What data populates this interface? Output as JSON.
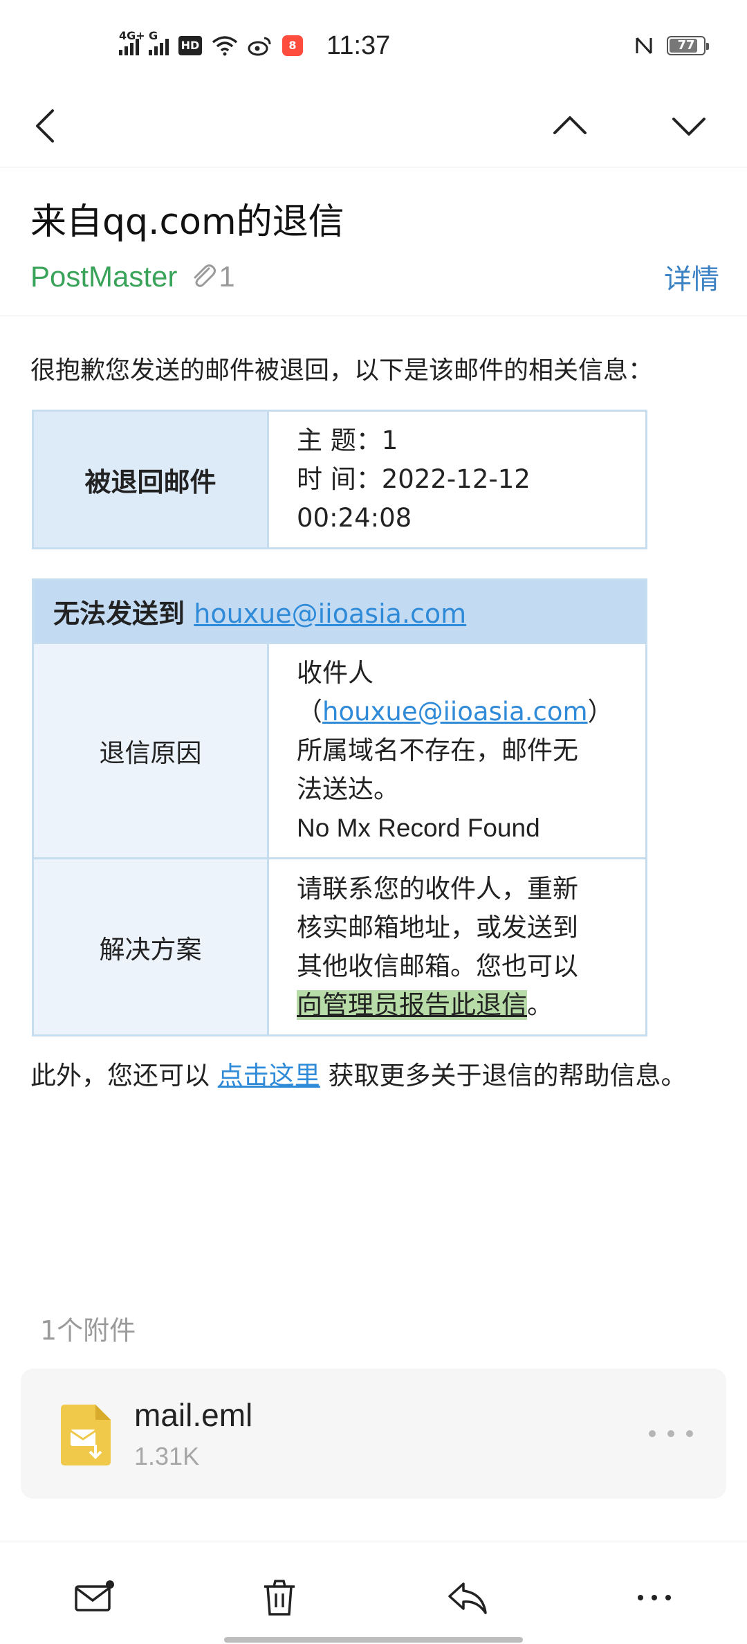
{
  "status_bar": {
    "net1": "4G+",
    "net2": "G",
    "hd": "HD",
    "app_badge": "8",
    "time": "11:37",
    "battery": "77"
  },
  "nav": {
    "back": "back-icon",
    "prev": "chevron-up-icon",
    "next": "chevron-down-icon"
  },
  "header": {
    "subject": "来自qq.com的退信",
    "sender": "PostMaster",
    "attachment_count": "1",
    "details": "详情"
  },
  "body": {
    "intro": "很抱歉您发送的邮件被退回，以下是该邮件的相关信息：",
    "returned_label": "被退回邮件",
    "subject_line": "主 题：1",
    "time_line_1": "时 间：2022-12-12",
    "time_line_2": "00:24:08",
    "cannot_send_label": "无法发送到",
    "recipient_email": "houxue@iioasia.com",
    "reason_label": "退信原因",
    "reason_prefix": "收件人",
    "reason_open_paren": "（",
    "reason_close_paren": "）",
    "reason_line_1": "所属域名不存在，邮件无",
    "reason_line_2": "法送达。",
    "reason_en": "No Mx Record Found",
    "solution_label": "解决方案",
    "solution_line_1": "请联系您的收件人，重新",
    "solution_line_2": "核实邮箱地址，或发送到",
    "solution_line_3": "其他收信邮箱。您也可以",
    "solution_link": "向管理员报告此退信",
    "solution_end": "。",
    "extra_prefix": "此外，您还可以 ",
    "extra_link": "点击这里",
    "extra_suffix": " 获取更多关于退信的帮助信息。"
  },
  "attachments": {
    "count_label": "1个附件",
    "file_name": "mail.eml",
    "file_size": "1.31K"
  },
  "bottom_bar": {
    "items": [
      "mail-icon",
      "trash-icon",
      "reply-icon",
      "more-icon"
    ]
  },
  "colors": {
    "sender": "#3aa35a",
    "link": "#2f8ad8",
    "details": "#3b82c4",
    "table_header": "#c3daf3",
    "table_label": "#ddeaf8",
    "highlight": "#b7dca8"
  }
}
